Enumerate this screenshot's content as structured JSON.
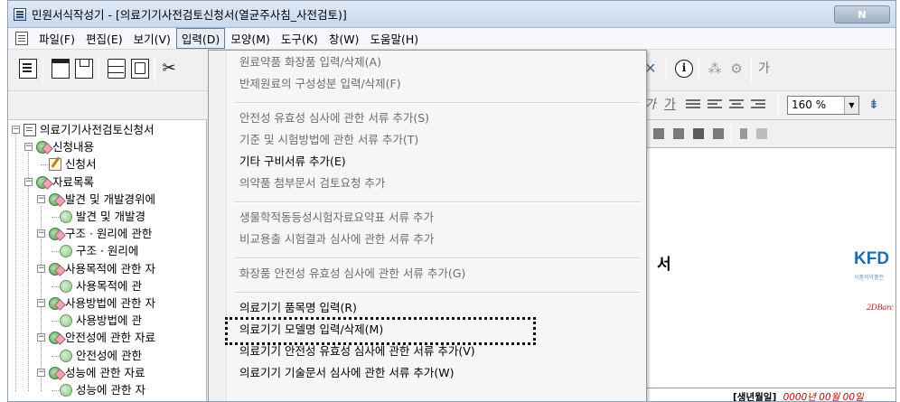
{
  "window": {
    "title": "민원서식작성기 - [의료기기사전검토신청서(열균주사침_사전검토)]",
    "title_button_text": "N"
  },
  "menubar": {
    "items": [
      "파일(F)",
      "편집(E)",
      "보기(V)",
      "입력(D)",
      "모양(M)",
      "도구(K)",
      "창(W)",
      "도움말(H)"
    ],
    "active_index": 3
  },
  "toolbar": {
    "zoom_value": "160 %",
    "icons": [
      "new-doc-icon",
      "open-icon",
      "save-icon",
      "print-icon",
      "preview-icon",
      "scissors-icon",
      "info-icon",
      "ga-icon"
    ],
    "format_glyphs": {
      "italic": "가",
      "underline": "가"
    },
    "extra_glyph": "가"
  },
  "tree": {
    "nodes": [
      {
        "label": "의료기기사전검토신청서",
        "level": 0,
        "icon": "doc",
        "expander": "−"
      },
      {
        "label": "신청내용",
        "level": 1,
        "icon": "folder",
        "expander": "−"
      },
      {
        "label": "신청서",
        "level": 2,
        "icon": "pencil",
        "expander": ""
      },
      {
        "label": "자료목록",
        "level": 1,
        "icon": "folder",
        "expander": "−"
      },
      {
        "label": "발견 및 개발경위에",
        "level": 2,
        "icon": "folder",
        "expander": "−"
      },
      {
        "label": "발견 및 개발경",
        "level": 3,
        "icon": "leaf",
        "expander": ""
      },
      {
        "label": "구조 · 원리에 관한",
        "level": 2,
        "icon": "folder",
        "expander": "−"
      },
      {
        "label": "구조 · 원리에",
        "level": 3,
        "icon": "leaf",
        "expander": ""
      },
      {
        "label": "사용목적에 관한 자",
        "level": 2,
        "icon": "folder",
        "expander": "−"
      },
      {
        "label": "사용목적에 관",
        "level": 3,
        "icon": "leaf",
        "expander": ""
      },
      {
        "label": "사용방법에 관한 자",
        "level": 2,
        "icon": "folder",
        "expander": "−"
      },
      {
        "label": "사용방법에 관",
        "level": 3,
        "icon": "leaf",
        "expander": ""
      },
      {
        "label": "안전성에 관한 자료",
        "level": 2,
        "icon": "folder",
        "expander": "−"
      },
      {
        "label": "안전성에 관한",
        "level": 3,
        "icon": "leaf",
        "expander": ""
      },
      {
        "label": "성능에 관한 자료",
        "level": 2,
        "icon": "folder",
        "expander": "−"
      },
      {
        "label": "성능에 관한 자",
        "level": 3,
        "icon": "leaf",
        "expander": ""
      }
    ]
  },
  "dropdown": {
    "items": [
      {
        "label": "원료약품 화장품 입력/삭제(A)",
        "enabled": false
      },
      {
        "label": "반제원료의 구성성분 입력/삭제(F)",
        "enabled": false
      },
      {
        "sep": true
      },
      {
        "label": "안전성 유효성 심사에 관한 서류 추가(S)",
        "enabled": false
      },
      {
        "label": "기준 및 시험방법에 관한 서류 추가(T)",
        "enabled": false
      },
      {
        "label": "기타 구비서류 추가(E)",
        "enabled": true
      },
      {
        "label": "의약품 첨부문서 검토요청 추가",
        "enabled": false
      },
      {
        "sep": true
      },
      {
        "label": "생물학적동등성시험자료요약표 서류 추가",
        "enabled": false
      },
      {
        "label": "비교용출 시험결과 심사에 관한 서류 추가",
        "enabled": false
      },
      {
        "sep": true
      },
      {
        "label": "화장품 안전성 유효성 심사에 관한 서류 추가(G)",
        "enabled": false
      },
      {
        "sep": true
      },
      {
        "label": "의료기기 품목명 입력(R)",
        "enabled": true,
        "highlighted": true
      },
      {
        "label": "의료기기 모델명 입력/삭제(M)",
        "enabled": true
      },
      {
        "label": "의료기기 안전성 유효성 심사에 관한 서류 추가(V)",
        "enabled": true
      },
      {
        "label": "의료기기 기술문서 심사에 관한 서류 추가(W)",
        "enabled": true
      }
    ]
  },
  "document": {
    "heading_fragment": "서",
    "logo_text": "KFD",
    "logo_subtext": "식품의약품안",
    "barcode_label": "2DBarc",
    "birth_label": "[생년월일]",
    "birth_value": "0000년 00월 00일"
  },
  "colors": {
    "menu_disabled": "#6d6d6d",
    "logo": "#1f6ea8",
    "birth_value": "#bb0000"
  }
}
